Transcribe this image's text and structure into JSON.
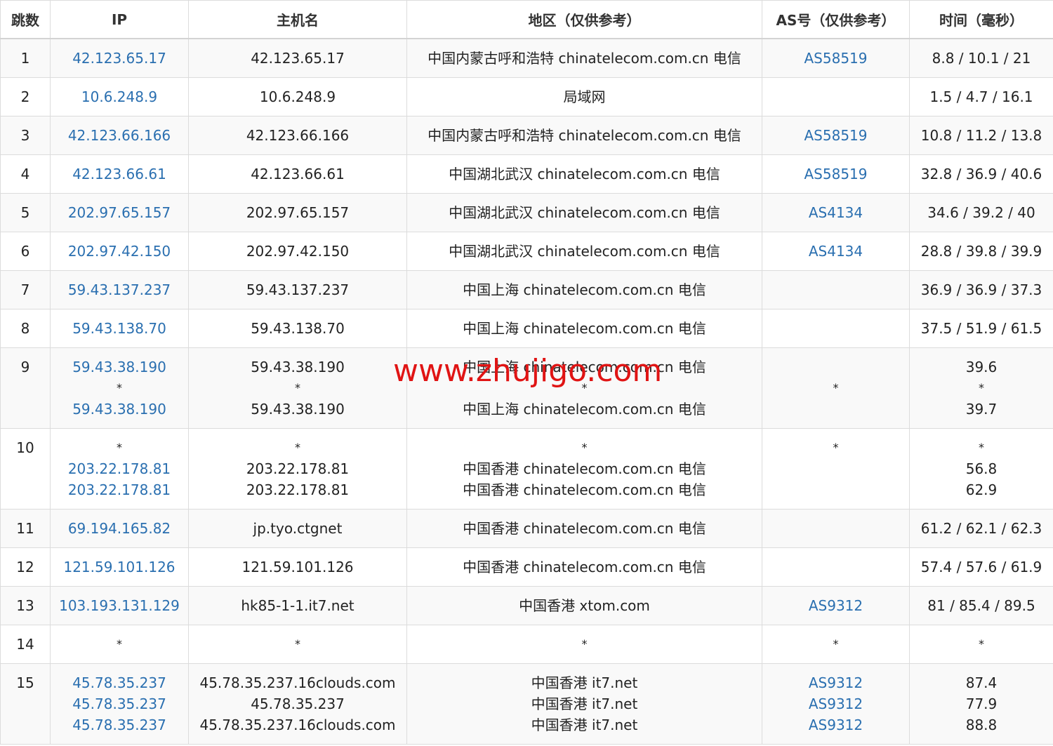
{
  "headers": {
    "hop": "跳数",
    "ip": "IP",
    "host": "主机名",
    "region": "地区（仅供参考）",
    "as": "AS号（仅供参考）",
    "time": "时间（毫秒）"
  },
  "rows": [
    {
      "hop": "1",
      "ip": [
        "42.123.65.17"
      ],
      "host": [
        "42.123.65.17"
      ],
      "region": [
        "中国内蒙古呼和浩特 chinatelecom.com.cn 电信"
      ],
      "as": [
        "AS58519"
      ],
      "time": [
        "8.8 / 10.1 / 21"
      ]
    },
    {
      "hop": "2",
      "ip": [
        "10.6.248.9"
      ],
      "host": [
        "10.6.248.9"
      ],
      "region": [
        "局域网"
      ],
      "as": [
        ""
      ],
      "time": [
        "1.5 / 4.7 / 16.1"
      ]
    },
    {
      "hop": "3",
      "ip": [
        "42.123.66.166"
      ],
      "host": [
        "42.123.66.166"
      ],
      "region": [
        "中国内蒙古呼和浩特 chinatelecom.com.cn 电信"
      ],
      "as": [
        "AS58519"
      ],
      "time": [
        "10.8 / 11.2 / 13.8"
      ]
    },
    {
      "hop": "4",
      "ip": [
        "42.123.66.61"
      ],
      "host": [
        "42.123.66.61"
      ],
      "region": [
        "中国湖北武汉 chinatelecom.com.cn 电信"
      ],
      "as": [
        "AS58519"
      ],
      "time": [
        "32.8 / 36.9 / 40.6"
      ]
    },
    {
      "hop": "5",
      "ip": [
        "202.97.65.157"
      ],
      "host": [
        "202.97.65.157"
      ],
      "region": [
        "中国湖北武汉 chinatelecom.com.cn 电信"
      ],
      "as": [
        "AS4134"
      ],
      "time": [
        "34.6 / 39.2 / 40"
      ]
    },
    {
      "hop": "6",
      "ip": [
        "202.97.42.150"
      ],
      "host": [
        "202.97.42.150"
      ],
      "region": [
        "中国湖北武汉 chinatelecom.com.cn 电信"
      ],
      "as": [
        "AS4134"
      ],
      "time": [
        "28.8 / 39.8 / 39.9"
      ]
    },
    {
      "hop": "7",
      "ip": [
        "59.43.137.237"
      ],
      "host": [
        "59.43.137.237"
      ],
      "region": [
        "中国上海 chinatelecom.com.cn 电信"
      ],
      "as": [
        ""
      ],
      "time": [
        "36.9 / 36.9 / 37.3"
      ]
    },
    {
      "hop": "8",
      "ip": [
        "59.43.138.70"
      ],
      "host": [
        "59.43.138.70"
      ],
      "region": [
        "中国上海 chinatelecom.com.cn 电信"
      ],
      "as": [
        ""
      ],
      "time": [
        "37.5 / 51.9 / 61.5"
      ]
    },
    {
      "hop": "9",
      "ip": [
        "59.43.38.190",
        "*",
        "59.43.38.190"
      ],
      "host": [
        "59.43.38.190",
        "*",
        "59.43.38.190"
      ],
      "region": [
        "中国上海 chinatelecom.com.cn 电信",
        "*",
        "中国上海 chinatelecom.com.cn 电信"
      ],
      "as": [
        "",
        "*",
        ""
      ],
      "time": [
        "39.6",
        "*",
        "39.7"
      ]
    },
    {
      "hop": "10",
      "ip": [
        "*",
        "203.22.178.81",
        "203.22.178.81"
      ],
      "host": [
        "*",
        "203.22.178.81",
        "203.22.178.81"
      ],
      "region": [
        "*",
        "中国香港 chinatelecom.com.cn 电信",
        "中国香港 chinatelecom.com.cn 电信"
      ],
      "as": [
        "*",
        "",
        ""
      ],
      "time": [
        "*",
        "56.8",
        "62.9"
      ]
    },
    {
      "hop": "11",
      "ip": [
        "69.194.165.82"
      ],
      "host": [
        "jp.tyo.ctgnet"
      ],
      "region": [
        "中国香港 chinatelecom.com.cn 电信"
      ],
      "as": [
        ""
      ],
      "time": [
        "61.2 / 62.1 / 62.3"
      ]
    },
    {
      "hop": "12",
      "ip": [
        "121.59.101.126"
      ],
      "host": [
        "121.59.101.126"
      ],
      "region": [
        "中国香港 chinatelecom.com.cn 电信"
      ],
      "as": [
        ""
      ],
      "time": [
        "57.4 / 57.6 / 61.9"
      ]
    },
    {
      "hop": "13",
      "ip": [
        "103.193.131.129"
      ],
      "host": [
        "hk85-1-1.it7.net"
      ],
      "region": [
        "中国香港 xtom.com"
      ],
      "as": [
        "AS9312"
      ],
      "time": [
        "81 / 85.4 / 89.5"
      ]
    },
    {
      "hop": "14",
      "ip": [
        "*"
      ],
      "host": [
        "*"
      ],
      "region": [
        "*"
      ],
      "as": [
        "*"
      ],
      "time": [
        "*"
      ]
    },
    {
      "hop": "15",
      "ip": [
        "45.78.35.237",
        "45.78.35.237",
        "45.78.35.237"
      ],
      "host": [
        "45.78.35.237.16clouds.com",
        "45.78.35.237",
        "45.78.35.237.16clouds.com"
      ],
      "region": [
        "中国香港 it7.net",
        "中国香港 it7.net",
        "中国香港 it7.net"
      ],
      "as": [
        "AS9312",
        "AS9312",
        "AS9312"
      ],
      "time": [
        "87.4",
        "77.9",
        "88.8"
      ]
    }
  ],
  "watermark": "www.zhujigo.com"
}
